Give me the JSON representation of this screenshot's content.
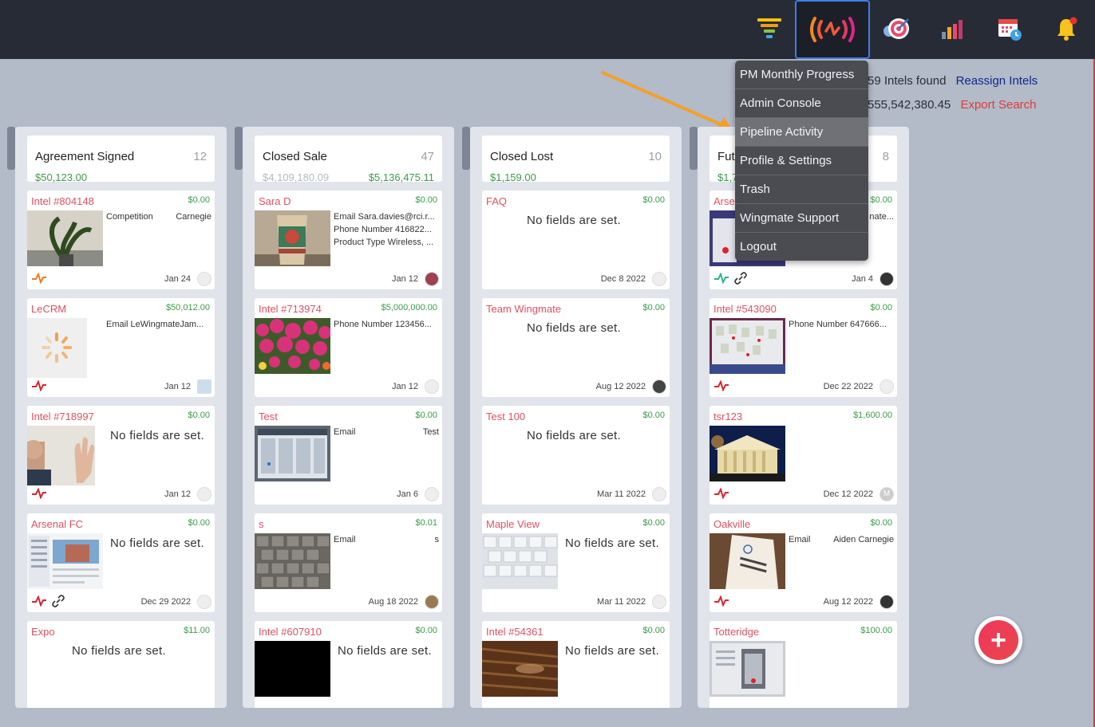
{
  "colors": {
    "topbar": "#272b35",
    "accent_red": "#e05160",
    "money_green": "#3d9b4a",
    "link_blue": "#0b2a8c",
    "export_red": "#e03a3a"
  },
  "toolbar": {
    "icons": [
      "funnel-icon",
      "pipeline-activity-icon",
      "target-icon",
      "bar-chart-icon",
      "calendar-icon",
      "bell-icon"
    ]
  },
  "summary": {
    "intels_found": "59 Intels found",
    "reassign": "Reassign Intels",
    "total": "555,542,380.45",
    "export": "Export Search"
  },
  "menu": {
    "items": [
      "PM Monthly Progress",
      "Admin Console",
      "Pipeline Activity",
      "Profile & Settings",
      "Trash",
      "Wingmate Support",
      "Logout"
    ],
    "highlighted": "Pipeline Activity"
  },
  "columns": [
    {
      "title": "Agreement Signed",
      "count": "12",
      "total": "$50,123.00",
      "cards": [
        {
          "title": "Intel #804148",
          "amount": "$0.00",
          "field1": "Competition",
          "field1_value": "Carnegie",
          "date": "Jan 24"
        },
        {
          "title": "LeCRM",
          "amount": "$50,012.00",
          "field1": "Email  LeWingmateJam...",
          "date": "Jan 12"
        },
        {
          "title": "Intel #718997",
          "amount": "$0.00",
          "nofields": "No fields are set.",
          "date": "Jan 12"
        },
        {
          "title": "Arsenal FC",
          "amount": "$0.00",
          "nofields": "No fields are set.",
          "date": "Dec 29 2022"
        },
        {
          "title": "Expo",
          "amount": "$11.00",
          "nofields": "No fields are set."
        }
      ]
    },
    {
      "title": "Closed Sale",
      "count": "47",
      "total": "$4,109,180.09",
      "total2": "$5,136,475.11",
      "cards": [
        {
          "title": "Sara D",
          "amount": "$0.00",
          "field1": "Email  Sara.davies@rci.r...",
          "field2": "Phone Number  416822...",
          "field3": "Product Type  Wireless, ...",
          "date": "Jan 12"
        },
        {
          "title": "Intel #713974",
          "amount": "$5,000,000.00",
          "field1": "Phone Number  123456...",
          "date": "Jan 12"
        },
        {
          "title": "Test",
          "amount": "$0.00",
          "field1": "Email",
          "field1_value": "Test",
          "date": "Jan 6"
        },
        {
          "title": "s",
          "amount": "$0.01",
          "field1": "Email",
          "field1_value": "s",
          "date": "Aug 18 2022"
        },
        {
          "title": "Intel #607910",
          "amount": "$0.00",
          "nofields": "No fields are set."
        }
      ]
    },
    {
      "title": "Closed Lost",
      "count": "10",
      "total": "$1,159.00",
      "cards": [
        {
          "title": "FAQ",
          "amount": "$0.00",
          "nofields": "No fields are set.",
          "date": "Dec 8 2022"
        },
        {
          "title": "Team Wingmate",
          "amount": "$0.00",
          "nofields": "No fields are set.",
          "date": "Aug 12 2022"
        },
        {
          "title": "Test 100",
          "amount": "$0.00",
          "nofields": "No fields are set.",
          "date": "Mar 11 2022"
        },
        {
          "title": "Maple View",
          "amount": "$0.00",
          "nofields": "No fields are set.",
          "date": "Mar 11 2022"
        },
        {
          "title": "Intel #54361",
          "amount": "$0.00",
          "nofields": "No fields are set."
        }
      ]
    },
    {
      "title": "Fut",
      "count": "8",
      "total": "$1,7",
      "cards": [
        {
          "title": "Arse",
          "amount": "$0.00",
          "field1": "nate...",
          "date": "Jan 4"
        },
        {
          "title": "Intel #543090",
          "amount": "$0.00",
          "field1": "Phone Number  647666...",
          "date": "Dec 22 2022"
        },
        {
          "title": "tsr123",
          "amount": "$1,600.00",
          "date": "Dec 12 2022",
          "avatar_initial": "M"
        },
        {
          "title": "Oakville",
          "amount": "$0.00",
          "field1": "Email",
          "field1_value": "Aiden Carnegie",
          "date": "Aug 12 2022"
        },
        {
          "title": "Totteridge",
          "amount": "$100.00"
        }
      ]
    }
  ],
  "fab": {
    "label": "+"
  }
}
